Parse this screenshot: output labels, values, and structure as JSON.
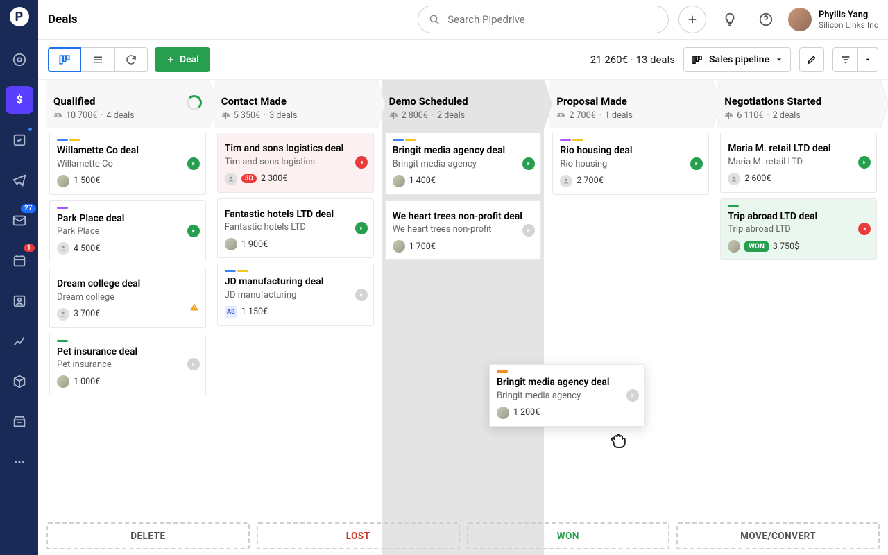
{
  "header": {
    "title": "Deals",
    "search_placeholder": "Search Pipedrive",
    "user": {
      "name": "Phyllis Yang",
      "org": "Silicon Links Inc"
    }
  },
  "sidebar": {
    "badge_mail": "27",
    "badge_activity": "1"
  },
  "toolbar": {
    "deal_button": "Deal",
    "pipeline_label": "Sales pipeline",
    "summary_amount": "21 260€",
    "summary_count": "13 deals"
  },
  "columns": [
    {
      "title": "Qualified",
      "amount": "10 700€",
      "count": "4 deals",
      "progress_ring": true,
      "cards": [
        {
          "colors": [
            "blue",
            "yellow"
          ],
          "title": "Willamette Co deal",
          "sub": "Willamette Co",
          "avatar": "photo",
          "amount": "1 500€",
          "status": "green"
        },
        {
          "colors": [
            "purple"
          ],
          "title": "Park Place deal",
          "sub": "Park Place",
          "avatar": "grey",
          "amount": "4 500€",
          "status": "green"
        },
        {
          "colors": [],
          "title": "Dream college deal",
          "sub": "Dream college",
          "avatar": "grey",
          "amount": "3 700€",
          "status": "",
          "warning": true
        },
        {
          "colors": [
            "green"
          ],
          "title": "Pet insurance deal",
          "sub": "Pet insurance",
          "avatar": "photo",
          "amount": "1 000€",
          "status": "grey"
        }
      ]
    },
    {
      "title": "Contact Made",
      "amount": "5 350€",
      "count": "3 deals",
      "cards": [
        {
          "colors": [],
          "title": "Tim and sons logistics deal",
          "sub": "Tim and sons logistics",
          "avatar": "grey",
          "pill": "3D",
          "amount": "2 300€",
          "status": "red",
          "warn_bg": true
        },
        {
          "colors": [],
          "title": "Fantastic hotels LTD deal",
          "sub": "Fantastic hotels LTD",
          "avatar": "photo",
          "amount": "1 900€",
          "status": "green"
        },
        {
          "colors": [
            "blue",
            "yellow"
          ],
          "title": "JD manufacturing deal",
          "sub": "JD manufacturing",
          "avatar": "ini",
          "ini": "AS",
          "amount": "1 150€",
          "status": "grey"
        }
      ]
    },
    {
      "title": "Demo Scheduled",
      "amount": "2 800€",
      "count": "2 deals",
      "drop_target": true,
      "cards": [
        {
          "colors": [
            "blue",
            "yellow"
          ],
          "title": "Bringit media agency deal",
          "sub": "Bringit media agency",
          "avatar": "photo",
          "amount": "1 400€",
          "status": "green"
        },
        {
          "colors": [],
          "title": "We heart trees non-profit deal",
          "sub": "We heart trees non-profit",
          "avatar": "photo",
          "amount": "1 700€",
          "status": "grey"
        }
      ]
    },
    {
      "title": "Proposal Made",
      "amount": "2 700€",
      "count": "1 deals",
      "cards": [
        {
          "colors": [
            "purple",
            "yellow"
          ],
          "title": "Rio housing deal",
          "sub": "Rio housing",
          "avatar": "grey",
          "amount": "2 700€",
          "status": "green"
        }
      ]
    },
    {
      "title": "Negotiations Started",
      "amount": "6 110€",
      "count": "2 deals",
      "cards": [
        {
          "colors": [],
          "title": "Maria M. retail LTD deal",
          "sub": "Maria M. retail LTD",
          "avatar": "grey",
          "amount": "2 600€",
          "status": "green"
        },
        {
          "colors": [
            "green"
          ],
          "title": "Trip abroad LTD deal",
          "sub": "Trip abroad LTD",
          "avatar": "photo",
          "amount": "3 750$",
          "status": "red",
          "won": true,
          "won_label": "WON"
        }
      ]
    }
  ],
  "dragging": {
    "colors": [
      "orange"
    ],
    "title": "Bringit media agency deal",
    "sub": "Bringit media agency",
    "amount": "1 200€"
  },
  "drop_zones": {
    "delete": "DELETE",
    "lost": "LOST",
    "won": "WON",
    "move": "MOVE/CONVERT"
  }
}
